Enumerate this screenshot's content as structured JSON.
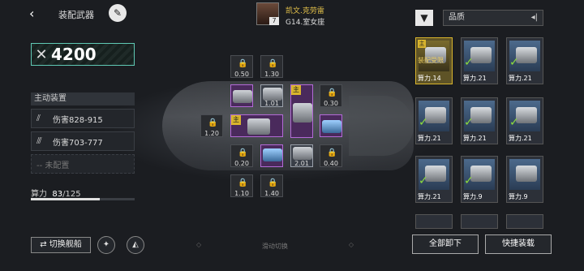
{
  "header": {
    "back_icon": "‹",
    "title": "装配武器"
  },
  "power": {
    "value": "4200"
  },
  "active_section": {
    "title": "主动装置"
  },
  "slots": [
    {
      "label": "伤害828-915"
    },
    {
      "label": "伤害703-777"
    },
    {
      "label": "-- 未配置"
    }
  ],
  "capacity": {
    "label": "算力",
    "value": "83",
    "max": "/125",
    "fraction": 0.664
  },
  "buttons": {
    "switch_ship": "⇄ 切换舰船",
    "swipe_switch": "滑动切换",
    "unequip_all": "全部卸下",
    "quick_equip": "快捷装载"
  },
  "character": {
    "name": "凯文.克劳雷",
    "location": "G14.室女座",
    "level": "7"
  },
  "grid": {
    "values": [
      "0.50",
      "1.30",
      "1.01",
      "0.30",
      "1.20",
      "0.20",
      "2.01",
      "0.40",
      "1.10",
      "1.40"
    ]
  },
  "filter": {
    "label": "品质"
  },
  "inventory": [
    {
      "power": "算力.14",
      "status": "装配受限",
      "tag": "主"
    },
    {
      "power": "算力.21"
    },
    {
      "power": "算力.21"
    },
    {
      "power": "算力.21"
    },
    {
      "power": "算力.21"
    },
    {
      "power": "算力.21"
    },
    {
      "power": "算力.21"
    },
    {
      "power": "算力.9"
    },
    {
      "power": "算力.9"
    }
  ],
  "tags": {
    "main": "主"
  }
}
